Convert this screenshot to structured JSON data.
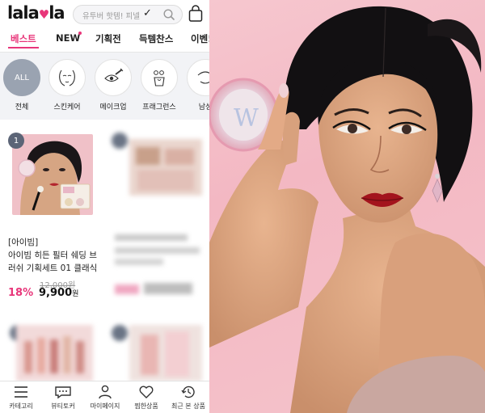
{
  "header": {
    "logo_text": "lalavla",
    "search_placeholder": "유투버 핫템! 피넬",
    "search_checkmark": "✓"
  },
  "gnb": [
    {
      "label": "베스트",
      "active": true
    },
    {
      "label": "NEW",
      "active": false
    },
    {
      "label": "기획전",
      "active": false
    },
    {
      "label": "득템찬스",
      "active": false
    },
    {
      "label": "이벤!",
      "active": false
    }
  ],
  "categories": [
    {
      "label": "전체",
      "circle_text": "ALL",
      "icon": "all-icon"
    },
    {
      "label": "스킨케어",
      "icon": "face-icon"
    },
    {
      "label": "메이크업",
      "icon": "eye-makeup-icon"
    },
    {
      "label": "프래그런스",
      "icon": "perfume-icon"
    },
    {
      "label": "남성",
      "icon": "men-icon"
    }
  ],
  "products": [
    {
      "rank": "1",
      "brand": "[아이빔]",
      "name": "아이빔 히든 필터 쉐딩 브러쉬 기획세트 01 클래식",
      "original_price": "12,000원",
      "discount": "18%",
      "price": "9,900",
      "price_unit": "원"
    }
  ],
  "tabbar": [
    {
      "label": "카테고리",
      "icon": "menu-icon"
    },
    {
      "label": "뷰티토커",
      "icon": "chat-icon"
    },
    {
      "label": "마이페이지",
      "icon": "person-icon"
    },
    {
      "label": "찜한상품",
      "icon": "heart-icon"
    },
    {
      "label": "최근 본 상품",
      "icon": "history-icon"
    }
  ],
  "colors": {
    "accent": "#e8367a",
    "category_bg": "#f2f3f6",
    "badge": "#5c6577",
    "photo_bg": "#f4bcc6"
  }
}
